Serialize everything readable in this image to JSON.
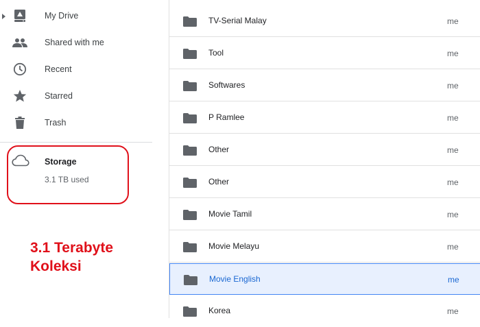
{
  "sidebar": {
    "items": [
      {
        "label": "My Drive",
        "icon": "drive-icon"
      },
      {
        "label": "Shared with me",
        "icon": "people-icon"
      },
      {
        "label": "Recent",
        "icon": "clock-icon"
      },
      {
        "label": "Starred",
        "icon": "star-icon"
      },
      {
        "label": "Trash",
        "icon": "trash-icon"
      }
    ],
    "storage": {
      "title": "Storage",
      "used": "3.1 TB used",
      "icon": "cloud-icon"
    }
  },
  "annotation": {
    "line1": "3.1 Terabyte",
    "line2": "Koleksi",
    "color": "#e0101a"
  },
  "files": [
    {
      "name": "TV-Serial Malay",
      "owner": "me"
    },
    {
      "name": "Tool",
      "owner": "me"
    },
    {
      "name": "Softwares",
      "owner": "me"
    },
    {
      "name": "P Ramlee",
      "owner": "me"
    },
    {
      "name": "Other",
      "owner": "me"
    },
    {
      "name": "Other",
      "owner": "me"
    },
    {
      "name": "Movie Tamil",
      "owner": "me"
    },
    {
      "name": "Movie Melayu",
      "owner": "me"
    },
    {
      "name": "Movie English",
      "owner": "me",
      "selected": true
    },
    {
      "name": "Korea",
      "owner": "me"
    }
  ],
  "colors": {
    "selected_bg": "#e8f0fe",
    "selected_text": "#1967d2",
    "icon": "#5f6368"
  }
}
